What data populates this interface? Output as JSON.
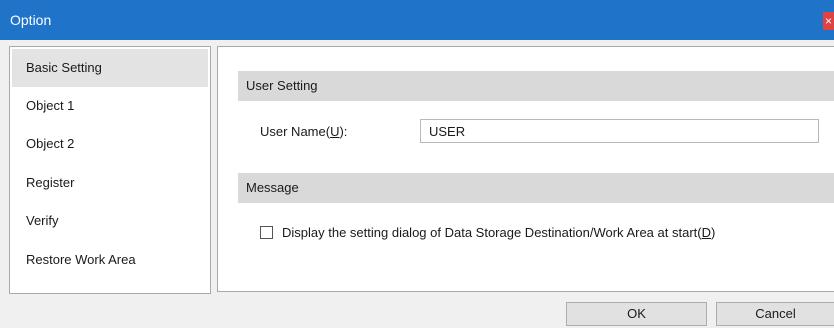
{
  "window": {
    "title": "Option",
    "close_glyph": "×"
  },
  "nav": {
    "items": [
      {
        "label": "Basic Setting",
        "selected": true
      },
      {
        "label": "Object 1"
      },
      {
        "label": "Object 2"
      },
      {
        "label": "Register"
      },
      {
        "label": "Verify"
      },
      {
        "label": "Restore Work Area"
      }
    ]
  },
  "user_setting": {
    "header": "User Setting",
    "user_name_label": "User Name(",
    "user_name_accel": "U",
    "user_name_suffix": "):",
    "user_name_value": "USER"
  },
  "message": {
    "header": "Message",
    "checkbox_label": "Display the setting dialog of Data Storage Destination/Work Area at start(",
    "checkbox_accel": "D",
    "checkbox_suffix": ")",
    "checked": false
  },
  "buttons": {
    "ok": "OK",
    "cancel": "Cancel"
  }
}
